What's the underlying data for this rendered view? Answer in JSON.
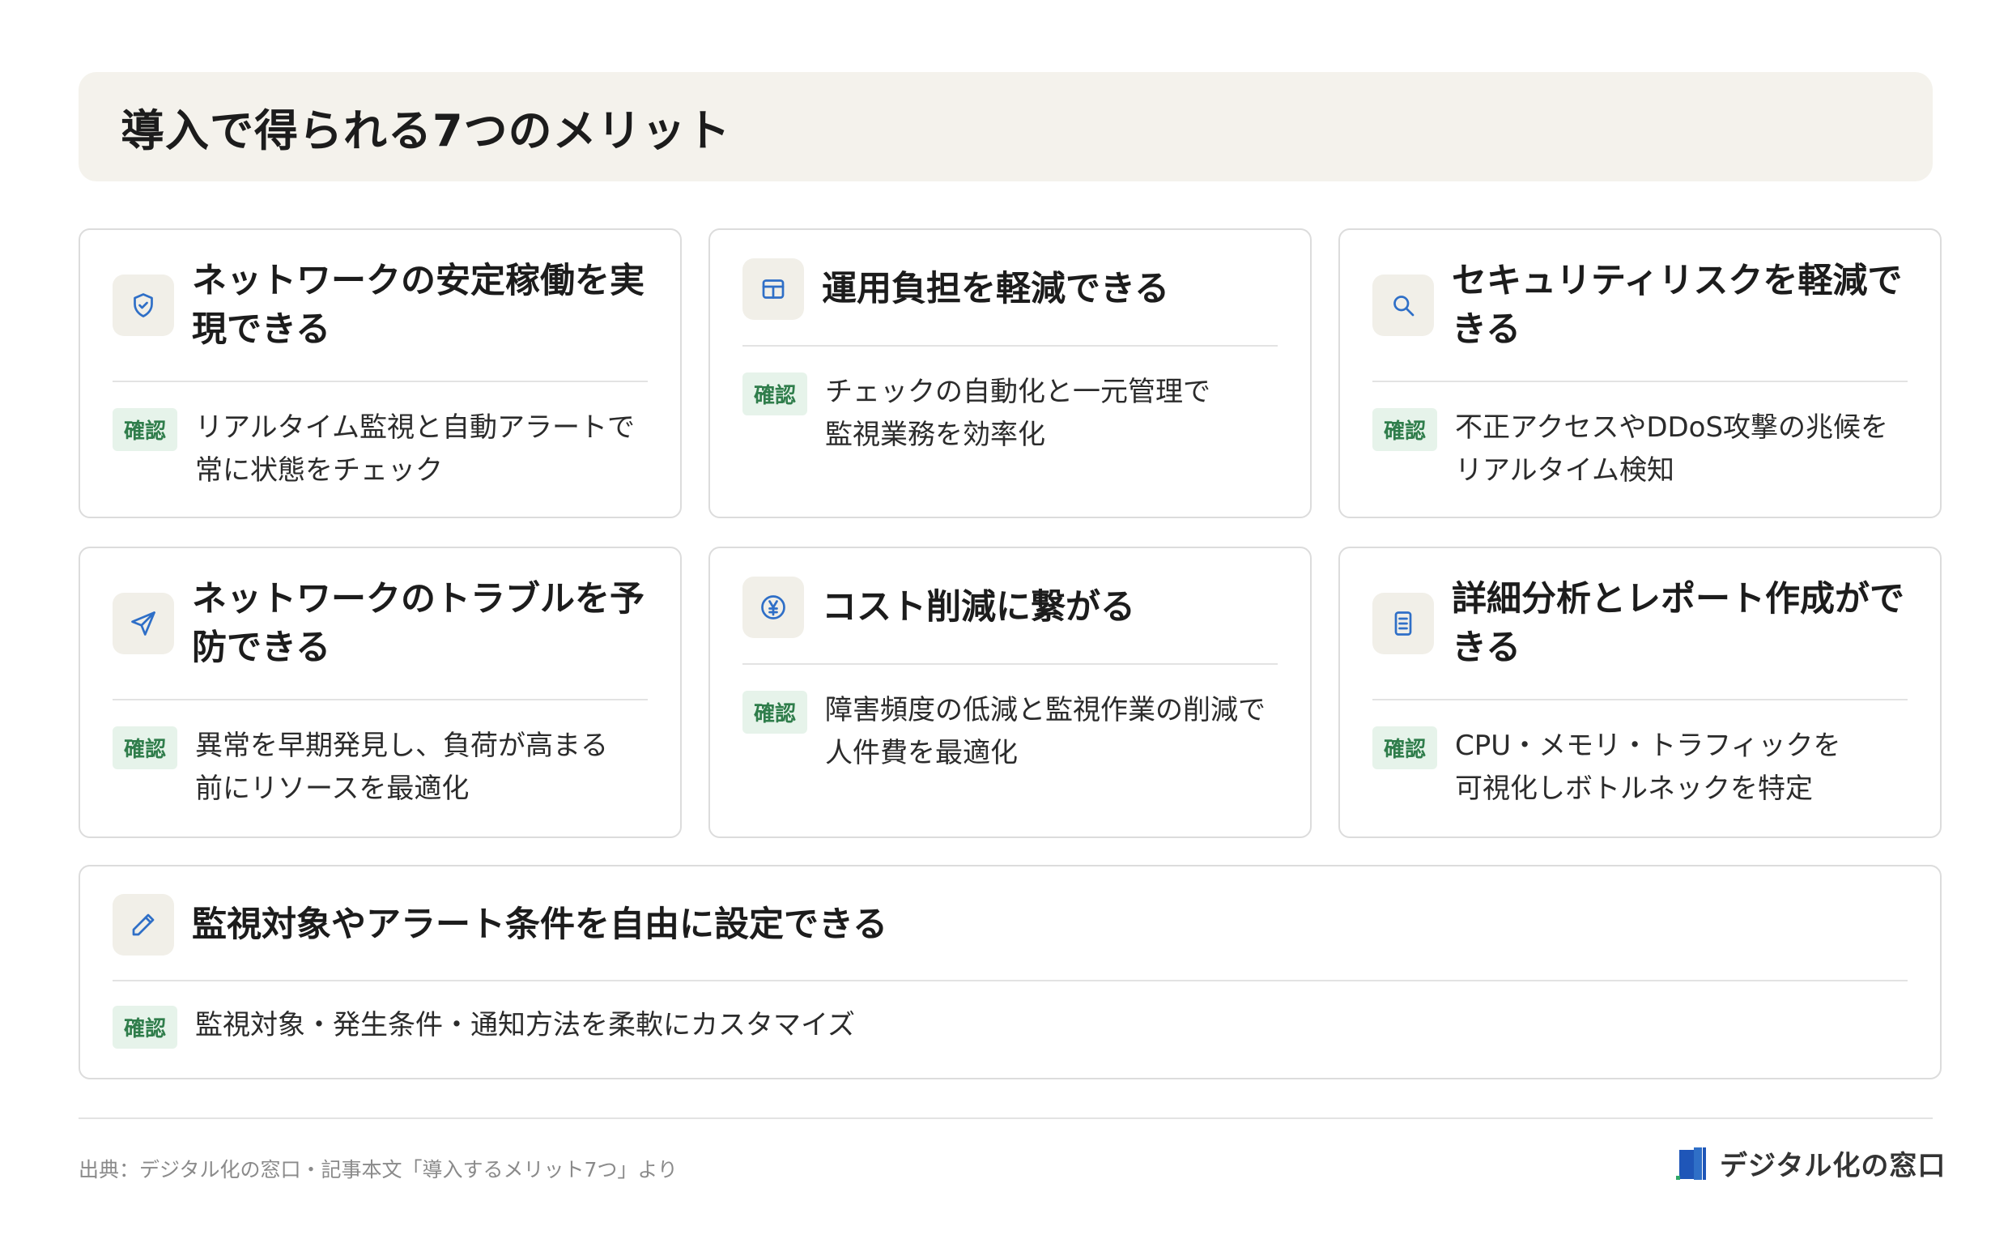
{
  "header": {
    "title": "導入で得られる7つのメリット"
  },
  "badge_label": "確認",
  "cards": [
    {
      "title_line1": "ネットワークの安定稼働を実",
      "title_line2": "現できる",
      "text_line1": "リアルタイム監視と自動アラートで",
      "text_line2": "常に状態をチェック",
      "icon": "shield-icon"
    },
    {
      "title_line1": "運用負担を軽減できる",
      "text_line1": "チェックの自動化と一元管理で",
      "text_line2": "監視業務を効率化",
      "icon": "window-grid-icon"
    },
    {
      "title_line1": "セキュリティリスクを軽減で",
      "title_line2": "きる",
      "text_line1": "不正アクセスやDDoS攻撃の兆候を",
      "text_line2": "リアルタイム検知",
      "icon": "search-icon"
    },
    {
      "title_line1": "ネットワークのトラブルを予",
      "title_line2": "防できる",
      "text_line1": "異常を早期発見し、負荷が高まる",
      "text_line2": "前にリソースを最適化",
      "icon": "send-icon"
    },
    {
      "title_line1": "コスト削減に繋がる",
      "text_line1": "障害頻度の低減と監視作業の削減で",
      "text_line2": "人件費を最適化",
      "icon": "yen-icon"
    },
    {
      "title_line1": "詳細分析とレポート作成がで",
      "title_line2": "きる",
      "text_line1": "CPU・メモリ・トラフィックを",
      "text_line2": "可視化しボトルネックを特定",
      "icon": "document-icon"
    },
    {
      "title_line1": "監視対象やアラート条件を自由に設定できる",
      "text_line1": "監視対象・発生条件・通知方法を柔軟にカスタマイズ",
      "icon": "pencil-icon"
    }
  ],
  "footer": {
    "source": "出典：デジタル化の窓口・記事本文「導入するメリット7つ」より",
    "brand": "デジタル化の窓口"
  },
  "colors": {
    "icon_blue": "#2f6fc7",
    "badge_green": "#2f7d4b",
    "badge_bg": "#e6f3ea",
    "header_bg": "#f4f2ec"
  }
}
